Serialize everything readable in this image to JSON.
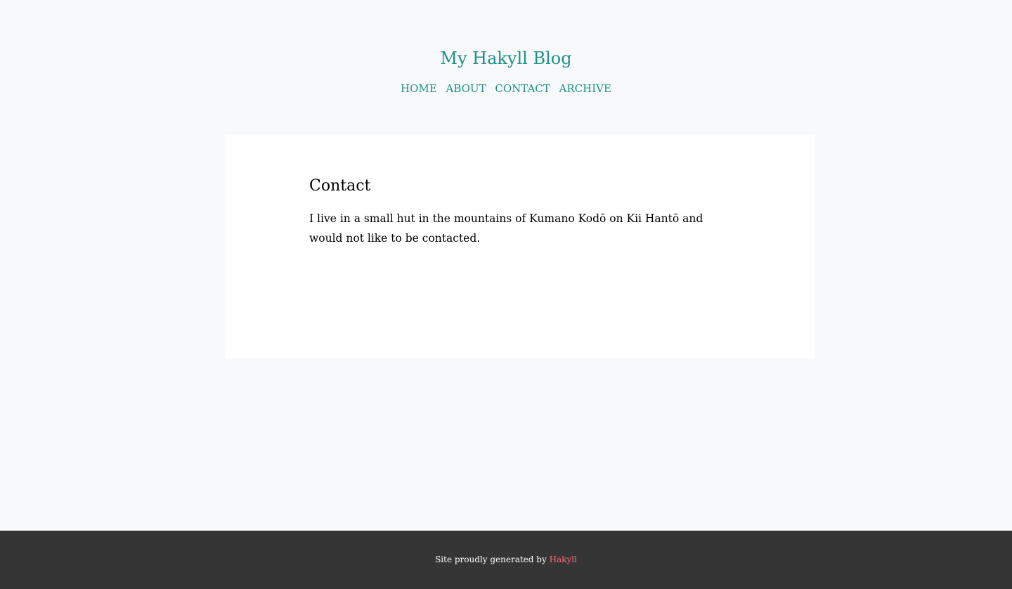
{
  "site": {
    "title": "My Hakyll Blog"
  },
  "nav": {
    "items": [
      {
        "label": "Home"
      },
      {
        "label": "About"
      },
      {
        "label": "Contact"
      },
      {
        "label": "Archive"
      }
    ]
  },
  "page": {
    "title": "Contact",
    "body": "I live in a small hut in the mountains of Kumano Kodō on Kii Hantō and would not like to be contacted."
  },
  "footer": {
    "prefix": "Site proudly generated by",
    "link_label": "Hakyll",
    "link_color": "#ff6b75"
  },
  "colors": {
    "accent": "#1f9083",
    "background": "#f7f9fa",
    "card": "#ffffff",
    "footer_bg": "#353535"
  }
}
